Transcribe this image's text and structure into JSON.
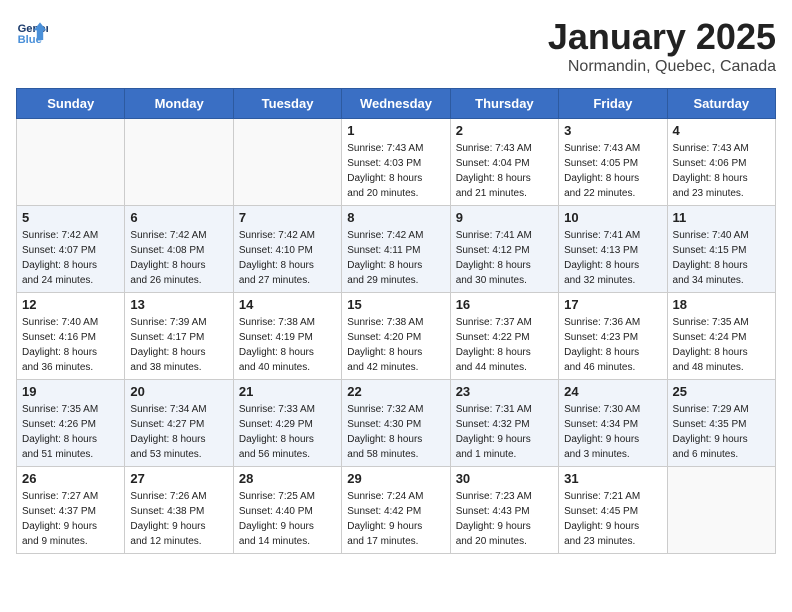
{
  "logo": {
    "line1": "General",
    "line2": "Blue"
  },
  "title": "January 2025",
  "location": "Normandin, Quebec, Canada",
  "days_of_week": [
    "Sunday",
    "Monday",
    "Tuesday",
    "Wednesday",
    "Thursday",
    "Friday",
    "Saturday"
  ],
  "weeks": [
    [
      {
        "day": "",
        "info": ""
      },
      {
        "day": "",
        "info": ""
      },
      {
        "day": "",
        "info": ""
      },
      {
        "day": "1",
        "info": "Sunrise: 7:43 AM\nSunset: 4:03 PM\nDaylight: 8 hours\nand 20 minutes."
      },
      {
        "day": "2",
        "info": "Sunrise: 7:43 AM\nSunset: 4:04 PM\nDaylight: 8 hours\nand 21 minutes."
      },
      {
        "day": "3",
        "info": "Sunrise: 7:43 AM\nSunset: 4:05 PM\nDaylight: 8 hours\nand 22 minutes."
      },
      {
        "day": "4",
        "info": "Sunrise: 7:43 AM\nSunset: 4:06 PM\nDaylight: 8 hours\nand 23 minutes."
      }
    ],
    [
      {
        "day": "5",
        "info": "Sunrise: 7:42 AM\nSunset: 4:07 PM\nDaylight: 8 hours\nand 24 minutes."
      },
      {
        "day": "6",
        "info": "Sunrise: 7:42 AM\nSunset: 4:08 PM\nDaylight: 8 hours\nand 26 minutes."
      },
      {
        "day": "7",
        "info": "Sunrise: 7:42 AM\nSunset: 4:10 PM\nDaylight: 8 hours\nand 27 minutes."
      },
      {
        "day": "8",
        "info": "Sunrise: 7:42 AM\nSunset: 4:11 PM\nDaylight: 8 hours\nand 29 minutes."
      },
      {
        "day": "9",
        "info": "Sunrise: 7:41 AM\nSunset: 4:12 PM\nDaylight: 8 hours\nand 30 minutes."
      },
      {
        "day": "10",
        "info": "Sunrise: 7:41 AM\nSunset: 4:13 PM\nDaylight: 8 hours\nand 32 minutes."
      },
      {
        "day": "11",
        "info": "Sunrise: 7:40 AM\nSunset: 4:15 PM\nDaylight: 8 hours\nand 34 minutes."
      }
    ],
    [
      {
        "day": "12",
        "info": "Sunrise: 7:40 AM\nSunset: 4:16 PM\nDaylight: 8 hours\nand 36 minutes."
      },
      {
        "day": "13",
        "info": "Sunrise: 7:39 AM\nSunset: 4:17 PM\nDaylight: 8 hours\nand 38 minutes."
      },
      {
        "day": "14",
        "info": "Sunrise: 7:38 AM\nSunset: 4:19 PM\nDaylight: 8 hours\nand 40 minutes."
      },
      {
        "day": "15",
        "info": "Sunrise: 7:38 AM\nSunset: 4:20 PM\nDaylight: 8 hours\nand 42 minutes."
      },
      {
        "day": "16",
        "info": "Sunrise: 7:37 AM\nSunset: 4:22 PM\nDaylight: 8 hours\nand 44 minutes."
      },
      {
        "day": "17",
        "info": "Sunrise: 7:36 AM\nSunset: 4:23 PM\nDaylight: 8 hours\nand 46 minutes."
      },
      {
        "day": "18",
        "info": "Sunrise: 7:35 AM\nSunset: 4:24 PM\nDaylight: 8 hours\nand 48 minutes."
      }
    ],
    [
      {
        "day": "19",
        "info": "Sunrise: 7:35 AM\nSunset: 4:26 PM\nDaylight: 8 hours\nand 51 minutes."
      },
      {
        "day": "20",
        "info": "Sunrise: 7:34 AM\nSunset: 4:27 PM\nDaylight: 8 hours\nand 53 minutes."
      },
      {
        "day": "21",
        "info": "Sunrise: 7:33 AM\nSunset: 4:29 PM\nDaylight: 8 hours\nand 56 minutes."
      },
      {
        "day": "22",
        "info": "Sunrise: 7:32 AM\nSunset: 4:30 PM\nDaylight: 8 hours\nand 58 minutes."
      },
      {
        "day": "23",
        "info": "Sunrise: 7:31 AM\nSunset: 4:32 PM\nDaylight: 9 hours\nand 1 minute."
      },
      {
        "day": "24",
        "info": "Sunrise: 7:30 AM\nSunset: 4:34 PM\nDaylight: 9 hours\nand 3 minutes."
      },
      {
        "day": "25",
        "info": "Sunrise: 7:29 AM\nSunset: 4:35 PM\nDaylight: 9 hours\nand 6 minutes."
      }
    ],
    [
      {
        "day": "26",
        "info": "Sunrise: 7:27 AM\nSunset: 4:37 PM\nDaylight: 9 hours\nand 9 minutes."
      },
      {
        "day": "27",
        "info": "Sunrise: 7:26 AM\nSunset: 4:38 PM\nDaylight: 9 hours\nand 12 minutes."
      },
      {
        "day": "28",
        "info": "Sunrise: 7:25 AM\nSunset: 4:40 PM\nDaylight: 9 hours\nand 14 minutes."
      },
      {
        "day": "29",
        "info": "Sunrise: 7:24 AM\nSunset: 4:42 PM\nDaylight: 9 hours\nand 17 minutes."
      },
      {
        "day": "30",
        "info": "Sunrise: 7:23 AM\nSunset: 4:43 PM\nDaylight: 9 hours\nand 20 minutes."
      },
      {
        "day": "31",
        "info": "Sunrise: 7:21 AM\nSunset: 4:45 PM\nDaylight: 9 hours\nand 23 minutes."
      },
      {
        "day": "",
        "info": ""
      }
    ]
  ]
}
